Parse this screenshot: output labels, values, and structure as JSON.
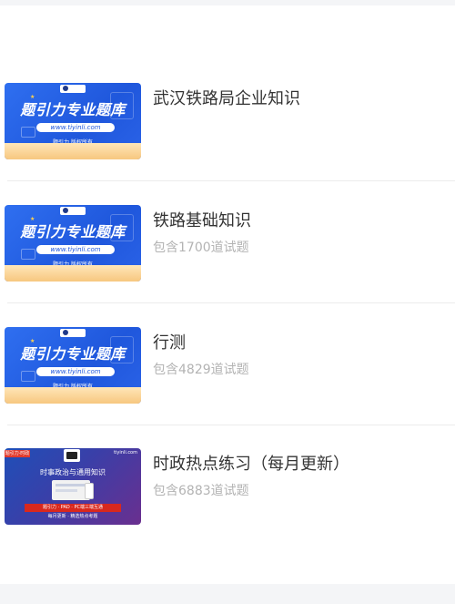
{
  "banner": {
    "headline": "题引力专业题库",
    "url": "www.tiyinli.com",
    "copyright": "题引力 版权所有"
  },
  "news_banner": {
    "tag": "题引力·时政",
    "site": "tiyinli.com",
    "headline": "时事政治与通用知识",
    "strip": "题引力 · PAD · PC端三端互通",
    "foot": "每月更新 · 精选热点考题"
  },
  "items": [
    {
      "title": "武汉铁路局企业知识",
      "subtitle": ""
    },
    {
      "title": "铁路基础知识",
      "subtitle": "包含1700道试题"
    },
    {
      "title": "行测",
      "subtitle": "包含4829道试题"
    },
    {
      "title": "时政热点练习（每月更新）",
      "subtitle": "包含6883道试题"
    }
  ],
  "colors": {
    "title": "#333333",
    "subtitle": "#b3b3b3",
    "divider": "#ececec",
    "banner_blue": "#1f57dc"
  }
}
